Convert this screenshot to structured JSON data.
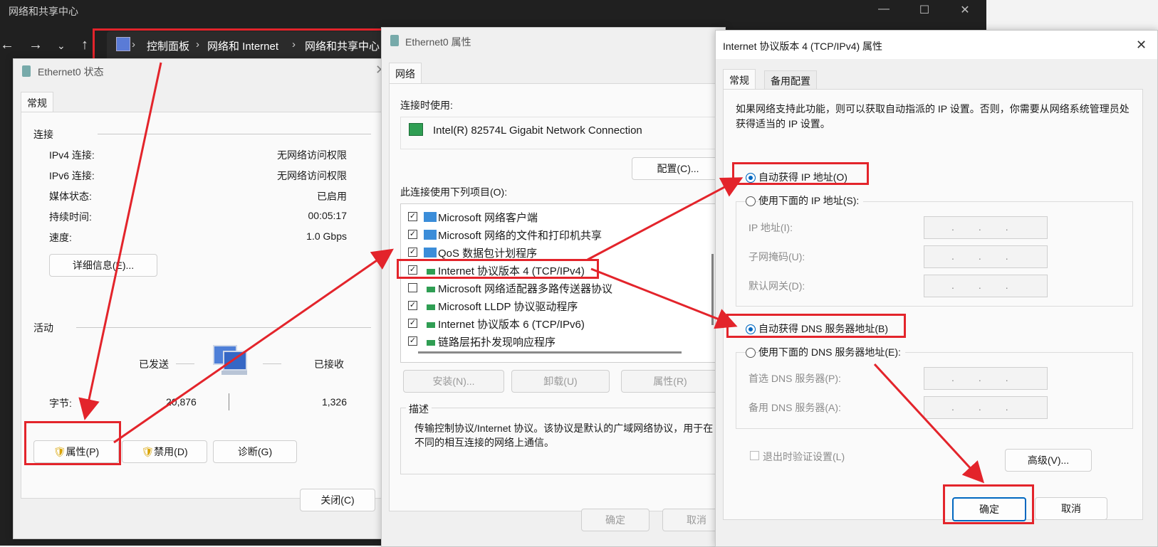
{
  "explorer": {
    "title": "网络和共享中心",
    "breadcrumb": [
      "控制面板",
      "网络和 Internet",
      "网络和共享中心"
    ]
  },
  "status_dialog": {
    "title": "Ethernet0 状态",
    "tab": "常规",
    "connection_header": "连接",
    "rows": [
      {
        "label": "IPv4 连接:",
        "value": "无网络访问权限"
      },
      {
        "label": "IPv6 连接:",
        "value": "无网络访问权限"
      },
      {
        "label": "媒体状态:",
        "value": "已启用"
      },
      {
        "label": "持续时间:",
        "value": "00:05:17"
      },
      {
        "label": "速度:",
        "value": "1.0 Gbps"
      }
    ],
    "details_button": "详细信息(E)...",
    "activity_header": "活动",
    "sent_label": "已发送",
    "received_label": "已接收",
    "bytes_label": "字节:",
    "bytes_sent": "20,876",
    "bytes_received": "1,326",
    "properties_button": "属性(P)",
    "disable_button": "禁用(D)",
    "diagnose_button": "诊断(G)",
    "close_button": "关闭(C)"
  },
  "props_dialog": {
    "title": "Ethernet0 属性",
    "tab": "网络",
    "connect_using_label": "连接时使用:",
    "adapter": "Intel(R) 82574L Gigabit Network Connection",
    "configure_button": "配置(C)...",
    "items_label": "此连接使用下列项目(O):",
    "items": [
      {
        "label": "Microsoft 网络客户端",
        "checked": true,
        "icon": "network-client-icon"
      },
      {
        "label": "Microsoft 网络的文件和打印机共享",
        "checked": true,
        "icon": "file-share-icon"
      },
      {
        "label": "QoS 数据包计划程序",
        "checked": true,
        "icon": "qos-icon"
      },
      {
        "label": "Internet 协议版本 4 (TCP/IPv4)",
        "checked": true,
        "icon": "protocol-icon"
      },
      {
        "label": "Microsoft 网络适配器多路传送器协议",
        "checked": false,
        "icon": "protocol-icon"
      },
      {
        "label": "Microsoft LLDP 协议驱动程序",
        "checked": true,
        "icon": "protocol-icon"
      },
      {
        "label": "Internet 协议版本 6 (TCP/IPv6)",
        "checked": true,
        "icon": "protocol-icon"
      },
      {
        "label": "链路层拓扑发现响应程序",
        "checked": true,
        "icon": "protocol-icon"
      }
    ],
    "install_button": "安装(N)...",
    "uninstall_button": "卸载(U)",
    "properties_button": "属性(R)",
    "description_header": "描述",
    "description": "传输控制协议/Internet 协议。该协议是默认的广域网络协议，用于在不同的相互连接的网络上通信。",
    "ok_button": "确定",
    "cancel_button": "取消"
  },
  "ipv4_dialog": {
    "title": "Internet 协议版本 4 (TCP/IPv4) 属性",
    "tab_general": "常规",
    "tab_alternate": "备用配置",
    "intro": "如果网络支持此功能，则可以获取自动指派的 IP 设置。否则，你需要从网络系统管理员处获得适当的 IP 设置。",
    "auto_ip": "自动获得 IP 地址(O)",
    "manual_ip": "使用下面的 IP 地址(S):",
    "ip_label": "IP 地址(I):",
    "mask_label": "子网掩码(U):",
    "gateway_label": "默认网关(D):",
    "auto_dns": "自动获得 DNS 服务器地址(B)",
    "manual_dns": "使用下面的 DNS 服务器地址(E):",
    "dns1_label": "首选 DNS 服务器(P):",
    "dns2_label": "备用 DNS 服务器(A):",
    "validate_label": "退出时验证设置(L)",
    "advanced_button": "高级(V)...",
    "ok_button": "确定",
    "cancel_button": "取消",
    "ip_dots": "..."
  },
  "colors": {
    "highlight_red": "#e3242b",
    "accent": "#0067c0"
  }
}
